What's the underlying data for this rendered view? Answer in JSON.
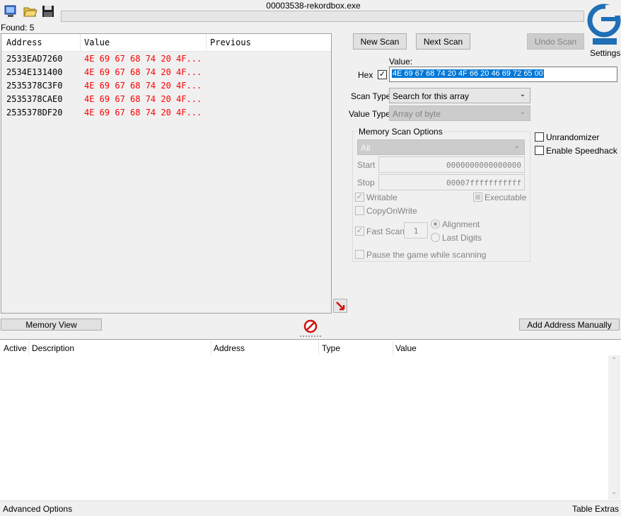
{
  "window": {
    "title": "00003538-rekordbox.exe"
  },
  "toolbar": {
    "open_process_icon": "computer-process-icon",
    "open_file_icon": "open-folder-icon",
    "save_icon": "floppy-disk-icon"
  },
  "found_label": "Found: 5",
  "results": {
    "columns": [
      "Address",
      "Value",
      "Previous"
    ],
    "rows": [
      {
        "address": "2533EAD7260",
        "value": "4E 69 67 68 74 20 4F...",
        "previous": ""
      },
      {
        "address": "2534E131400",
        "value": "4E 69 67 68 74 20 4F...",
        "previous": ""
      },
      {
        "address": "2535378C3F0",
        "value": "4E 69 67 68 74 20 4F...",
        "previous": ""
      },
      {
        "address": "2535378CAE0",
        "value": "4E 69 67 68 74 20 4F...",
        "previous": ""
      },
      {
        "address": "2535378DF20",
        "value": "4E 69 67 68 74 20 4F...",
        "previous": ""
      }
    ]
  },
  "buttons": {
    "new_scan": "New Scan",
    "next_scan": "Next Scan",
    "undo_scan": "Undo Scan",
    "memory_view": "Memory View",
    "add_address": "Add Address Manually"
  },
  "settings_label": "Settings",
  "value_label": "Value:",
  "hex_label": "Hex",
  "hex_checked": true,
  "value_input": "4E 69 67 68 74 20 4F 66 20 46 69 72 65 00",
  "scan_type": {
    "label": "Scan Type",
    "selected": "Search for this array"
  },
  "value_type": {
    "label": "Value Type",
    "selected": "Array of byte"
  },
  "memory_options": {
    "title": "Memory Scan Options",
    "region": "All",
    "start_label": "Start",
    "start_value": "0000000000000000",
    "stop_label": "Stop",
    "stop_value": "00007fffffffffff",
    "writable": "Writable",
    "executable": "Executable",
    "copy_on_write": "CopyOnWrite",
    "fast_scan": "Fast Scan",
    "fast_scan_value": "1",
    "alignment": "Alignment",
    "last_digits": "Last Digits",
    "pause": "Pause the game while scanning"
  },
  "unrandomizer": "Unrandomizer",
  "speedhack": "Enable Speedhack",
  "addresslist": {
    "columns": [
      "Active",
      "Description",
      "Address",
      "Type",
      "Value"
    ]
  },
  "status": {
    "left": "Advanced Options",
    "right": "Table Extras"
  },
  "colors": {
    "value_red": "#ff0000",
    "highlight": "#0078d7",
    "logo_blue": "#1e6fb5"
  }
}
